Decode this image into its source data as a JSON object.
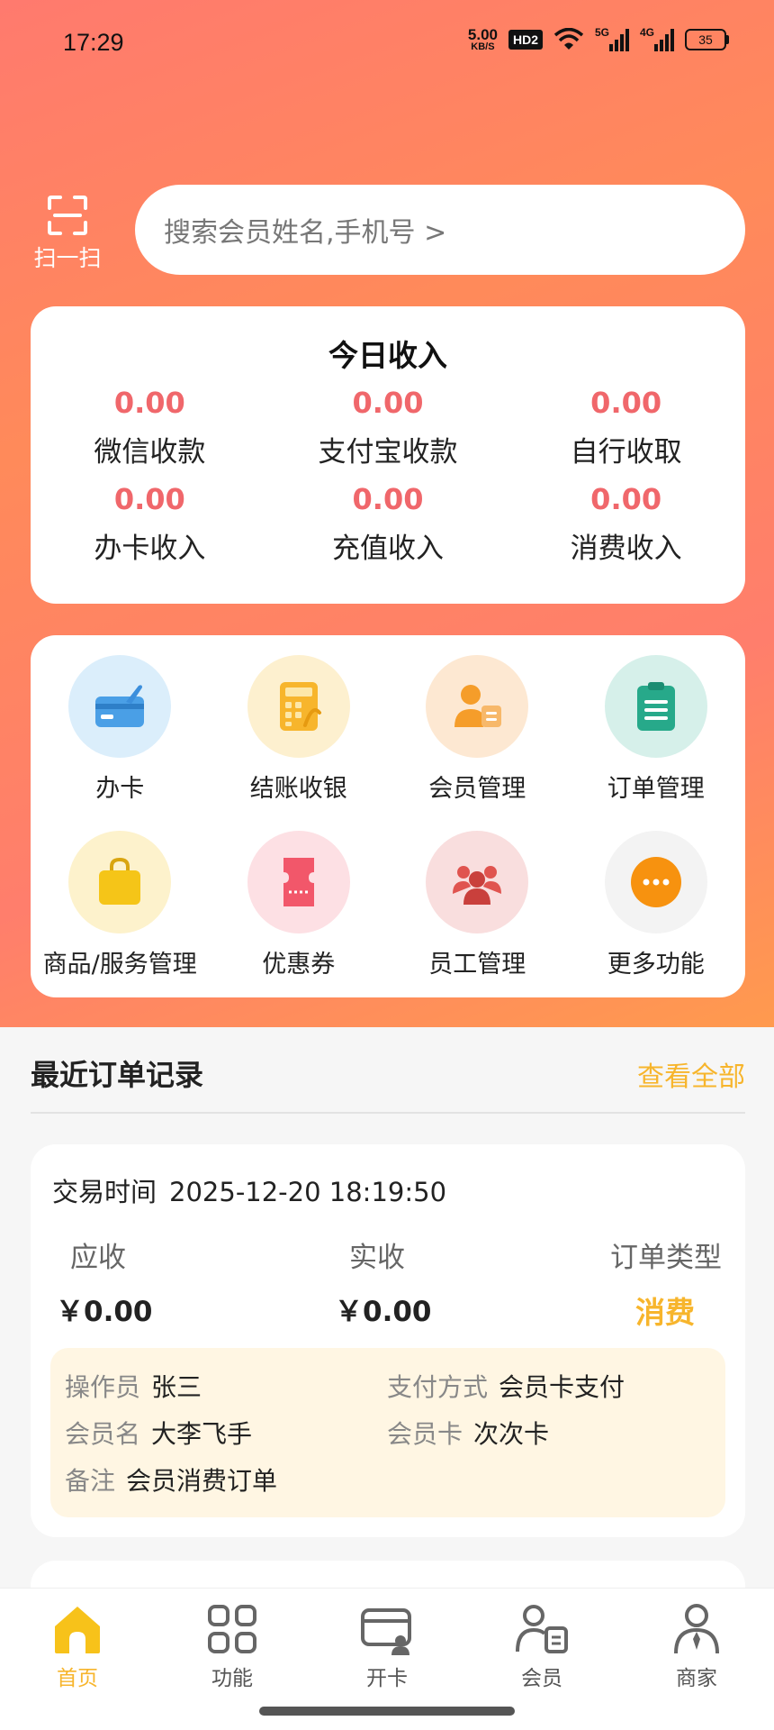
{
  "status_bar": {
    "time": "17:29",
    "net_speed_value": "5.00",
    "net_speed_unit": "KB/S",
    "hd_badge": "HD2",
    "signal_1_label": "5G",
    "signal_2_label": "4G",
    "battery": "35"
  },
  "scan": {
    "label": "扫一扫",
    "icon": "scan-icon"
  },
  "search": {
    "placeholder": "搜索会员姓名,手机号 >"
  },
  "income": {
    "title": "今日收入",
    "items": [
      {
        "value": "0.00",
        "label": "微信收款"
      },
      {
        "value": "0.00",
        "label": "支付宝收款"
      },
      {
        "value": "0.00",
        "label": "自行收取"
      },
      {
        "value": "0.00",
        "label": "办卡收入"
      },
      {
        "value": "0.00",
        "label": "充值收入"
      },
      {
        "value": "0.00",
        "label": "消费收入"
      }
    ]
  },
  "functions": [
    {
      "label": "办卡",
      "icon": "card-icon",
      "color": "#dbeefb"
    },
    {
      "label": "结账收银",
      "icon": "calculator-icon",
      "color": "#fdf0cf"
    },
    {
      "label": "会员管理",
      "icon": "member-icon",
      "color": "#fde8d2"
    },
    {
      "label": "订单管理",
      "icon": "clipboard-icon",
      "color": "#d6f0ea"
    },
    {
      "label": "商品/服务管理",
      "icon": "shopping-bag-icon",
      "color": "#fdf2cc"
    },
    {
      "label": "优惠券",
      "icon": "coupon-icon",
      "color": "#fde0e4"
    },
    {
      "label": "员工管理",
      "icon": "staff-icon",
      "color": "#f9dede"
    },
    {
      "label": "更多功能",
      "icon": "more-icon",
      "color": "#f3f3f3"
    }
  ],
  "orders": {
    "title": "最近订单记录",
    "view_all": "查看全部",
    "record": {
      "time_label": "交易时间",
      "time_value": "2025-12-20 18:19:50",
      "receivable_label": "应收",
      "received_label": "实收",
      "type_label": "订单类型",
      "receivable_value": "￥0.00",
      "received_value": "￥0.00",
      "type_value": "消费",
      "operator_label": "操作员",
      "operator_value": "张三",
      "pay_method_label": "支付方式",
      "pay_method_value": "会员卡支付",
      "member_name_label": "会员名",
      "member_name_value": "大李飞手",
      "member_card_label": "会员卡",
      "member_card_value": "次次卡",
      "remark_label": "备注",
      "remark_value": "会员消费订单"
    }
  },
  "bottom_nav": [
    {
      "label": "首页",
      "icon": "home-icon",
      "active": true
    },
    {
      "label": "功能",
      "icon": "grid-icon",
      "active": false
    },
    {
      "label": "开卡",
      "icon": "open-card-icon",
      "active": false
    },
    {
      "label": "会员",
      "icon": "member-card-icon",
      "active": false
    },
    {
      "label": "商家",
      "icon": "merchant-icon",
      "active": false
    }
  ],
  "colors": {
    "accent": "#f7b52c",
    "income_value": "#f0676b",
    "header_gradient_start": "#ff7a6e",
    "header_gradient_end": "#ff9a4e"
  }
}
